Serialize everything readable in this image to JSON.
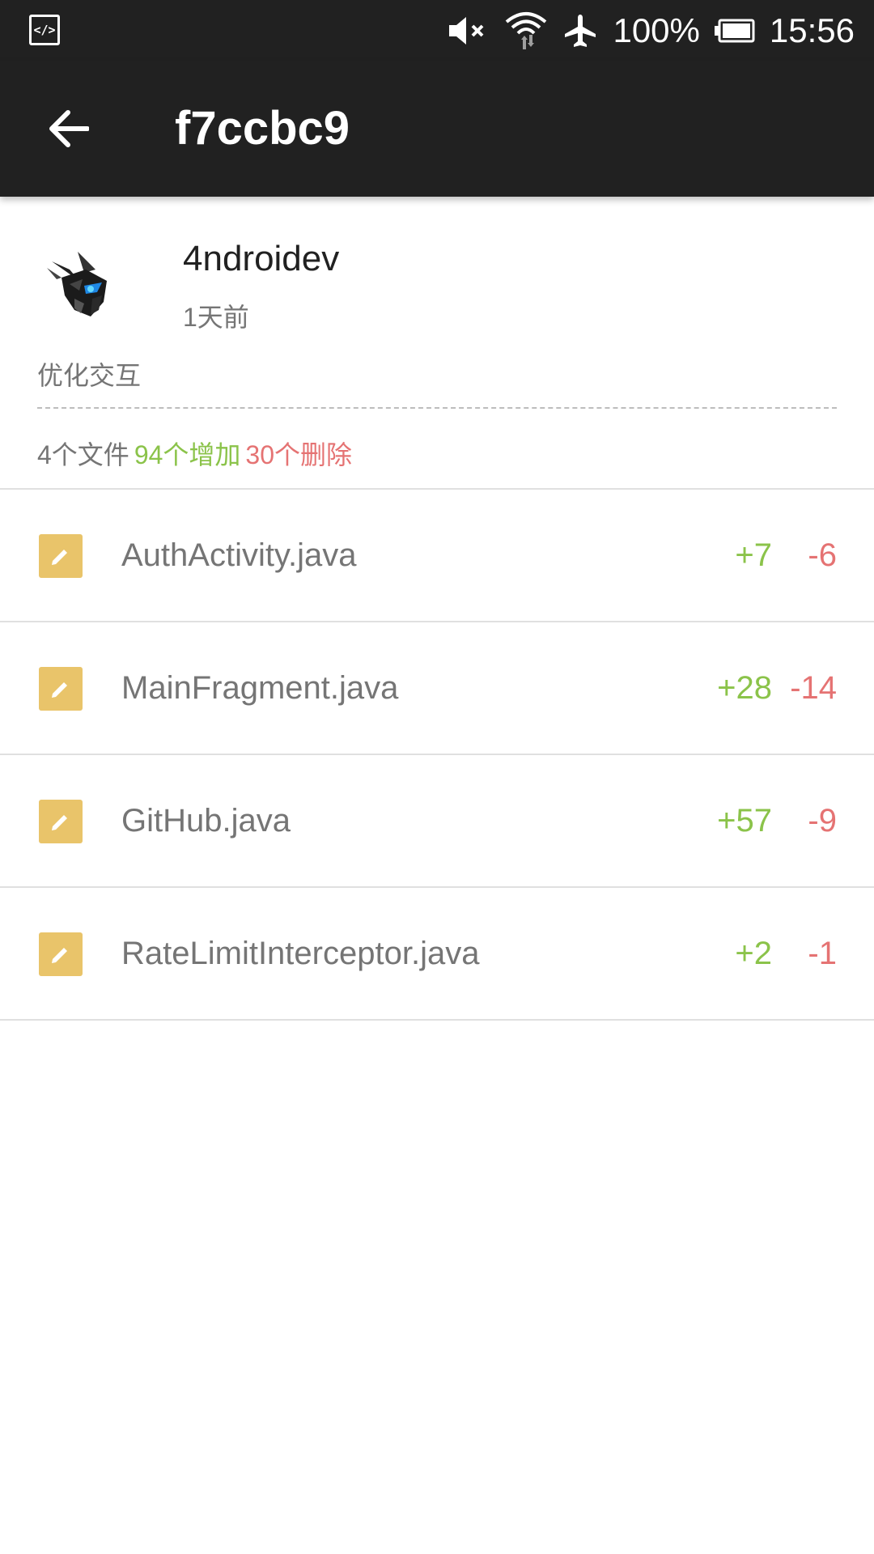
{
  "status_bar": {
    "battery": "100%",
    "time": "15:56",
    "left_icon": "developer-mode-icon",
    "icons": [
      "mute-icon",
      "wifi-icon",
      "airplane-icon",
      "battery-icon"
    ]
  },
  "app_bar": {
    "title": "f7ccbc9",
    "back_icon": "arrow-back-icon"
  },
  "commit": {
    "author": "4ndroidev",
    "time": "1天前",
    "message": "优化交互",
    "files_changed": "4个文件",
    "additions": "94个增加",
    "deletions": "30个删除"
  },
  "files": [
    {
      "name": "AuthActivity.java",
      "additions": "+7",
      "deletions": "-6",
      "icon": "edit-icon"
    },
    {
      "name": "MainFragment.java",
      "additions": "+28",
      "deletions": "-14",
      "icon": "edit-icon"
    },
    {
      "name": "GitHub.java",
      "additions": "+57",
      "deletions": "-9",
      "icon": "edit-icon"
    },
    {
      "name": "RateLimitInterceptor.java",
      "additions": "+2",
      "deletions": "-1",
      "icon": "edit-icon"
    }
  ],
  "colors": {
    "app_bar": "#212121",
    "additions": "#8bc34a",
    "deletions": "#e57373",
    "file_icon": "#e9c46a"
  }
}
